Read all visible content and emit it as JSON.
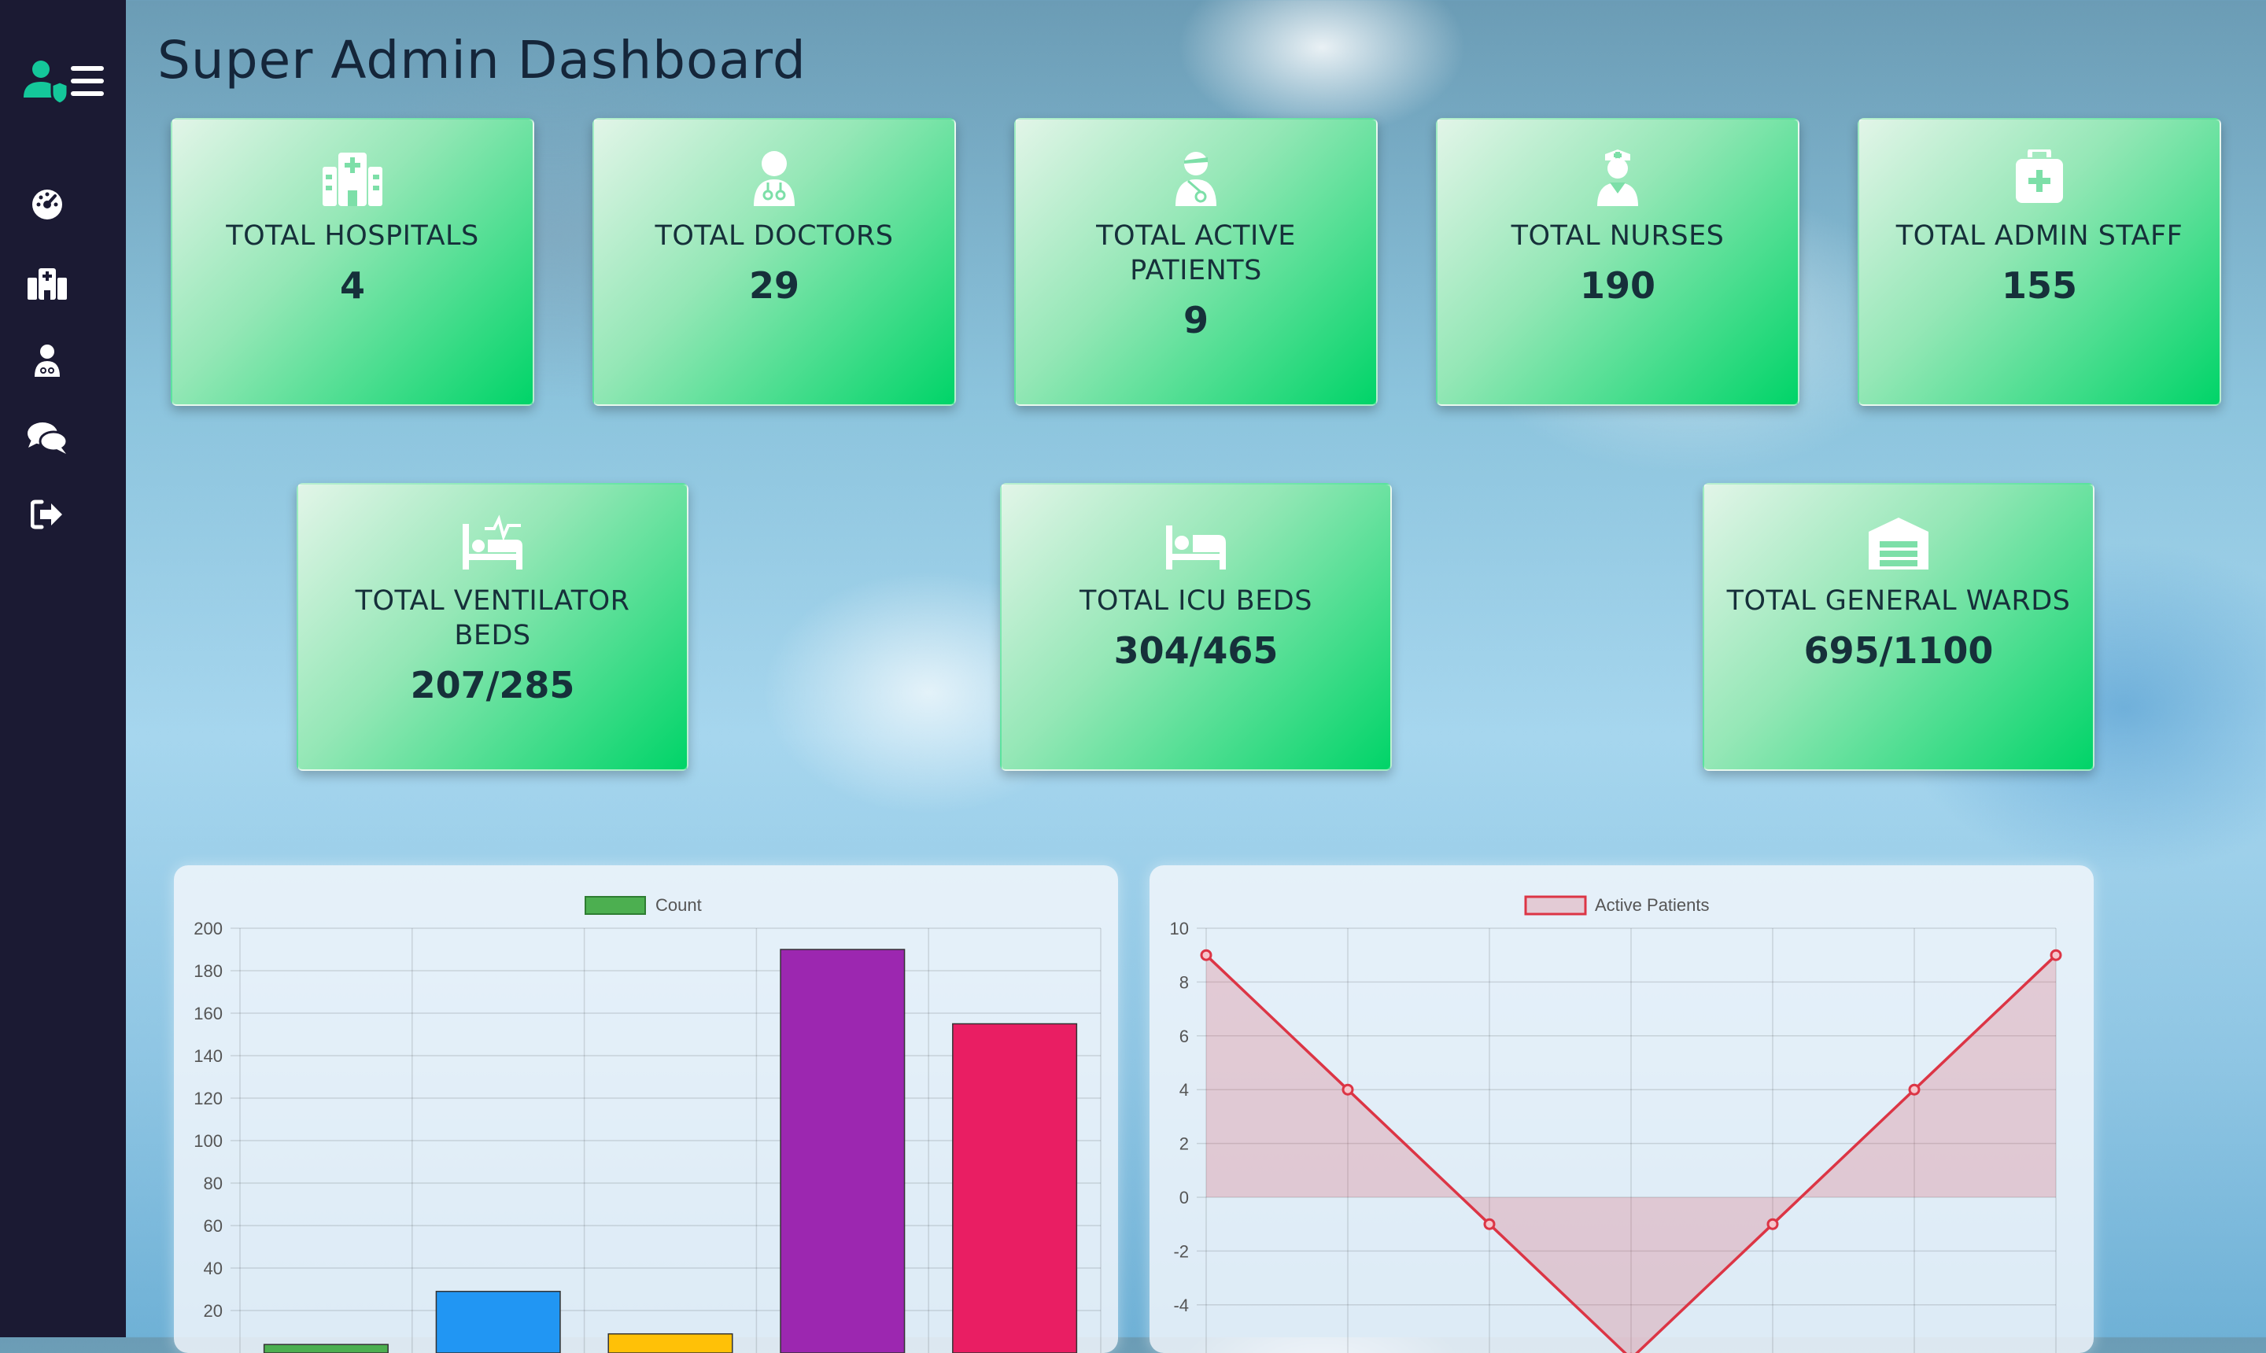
{
  "page": {
    "title": "Super Admin Dashboard"
  },
  "sidebar": {
    "brand_icon": "user-shield-menu-icon",
    "items": [
      {
        "name": "dashboard",
        "icon": "tachometer-icon"
      },
      {
        "name": "hospitals",
        "icon": "hospital-icon"
      },
      {
        "name": "doctors",
        "icon": "user-doctor-icon"
      },
      {
        "name": "chat",
        "icon": "comments-icon"
      },
      {
        "name": "logout",
        "icon": "sign-out-icon"
      }
    ]
  },
  "cards": [
    {
      "label": "TOTAL HOSPITALS",
      "value": "4",
      "icon": "hospital-icon"
    },
    {
      "label": "TOTAL DOCTORS",
      "value": "29",
      "icon": "user-doctor-icon"
    },
    {
      "label": "TOTAL ACTIVE PATIENTS",
      "value": "9",
      "icon": "patient-icon"
    },
    {
      "label": "TOTAL NURSES",
      "value": "190",
      "icon": "user-nurse-icon"
    },
    {
      "label": "TOTAL ADMIN STAFF",
      "value": "155",
      "icon": "medical-kit-icon"
    },
    {
      "label": "TOTAL VENTILATOR BEDS",
      "value": "207/285",
      "icon": "ventilator-bed-icon"
    },
    {
      "label": "TOTAL ICU BEDS",
      "value": "304/465",
      "icon": "bed-icon"
    },
    {
      "label": "TOTAL GENERAL WARDS",
      "value": "695/1100",
      "icon": "warehouse-icon"
    }
  ],
  "colors": {
    "card_accent": "#00d468",
    "sidebar": "#1b1a33",
    "title": "#15263a"
  },
  "chart_data": [
    {
      "type": "bar",
      "categories": [
        "",
        "",
        "",
        "",
        ""
      ],
      "series": [
        {
          "name": "Count",
          "values": [
            4,
            29,
            9,
            190,
            155
          ],
          "colors": [
            "#4caf50",
            "#2196f3",
            "#ffc107",
            "#9c27b0",
            "#e91e63"
          ]
        }
      ],
      "legend_color": "#4caf50",
      "ylim": [
        0,
        200
      ],
      "yticks": [
        200,
        180,
        160,
        140,
        120,
        100,
        80,
        60,
        40,
        20
      ],
      "grid": true,
      "legend": "top-center"
    },
    {
      "type": "line",
      "series": [
        {
          "name": "Active Patients",
          "values": [
            9,
            4,
            -1,
            -6,
            -1,
            4,
            9
          ],
          "color": "#dc3545",
          "fill": "rgba(220,53,69,0.2)"
        }
      ],
      "ylim": [
        -6,
        10
      ],
      "yticks": [
        10,
        8,
        6,
        4,
        2,
        0,
        -2,
        -4
      ],
      "grid": true,
      "legend": "top-center"
    }
  ]
}
